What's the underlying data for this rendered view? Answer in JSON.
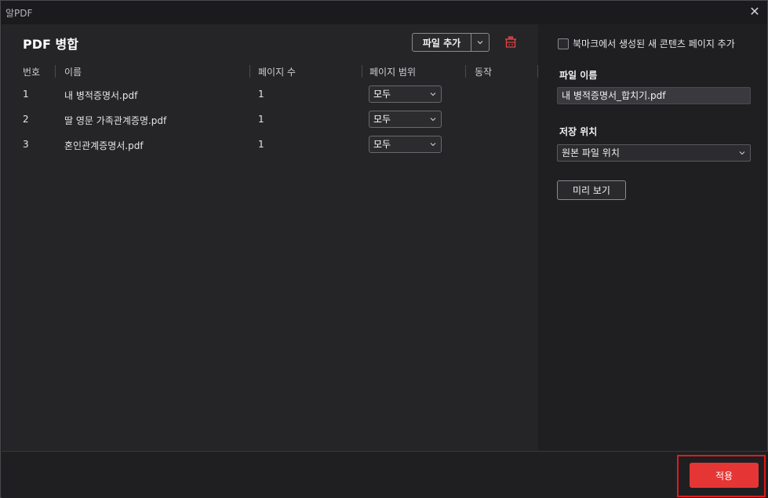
{
  "window": {
    "app_title": "알PDF"
  },
  "merge": {
    "title": "PDF 병합",
    "add_file_label": "파일 추가",
    "columns": {
      "number": "번호",
      "name": "이름",
      "pages": "페이지 수",
      "range": "페이지 범위",
      "action": "동작"
    },
    "files": [
      {
        "number": "1",
        "name": "내 병적증명서.pdf",
        "pages": "1",
        "range": "모두"
      },
      {
        "number": "2",
        "name": "딸 영문 가족관계증명.pdf",
        "pages": "1",
        "range": "모두"
      },
      {
        "number": "3",
        "name": "혼인관계증명서.pdf",
        "pages": "1",
        "range": "모두"
      }
    ]
  },
  "options": {
    "bookmark_label": "북마크에서 생성된 새 콘텐츠 페이지 추가",
    "file_name_label": "파일 이름",
    "file_name_value": "내 병적증명서_합치기.pdf",
    "save_location_label": "저장 위치",
    "save_location_value": "원본 파일 위치",
    "preview_label": "미리 보기"
  },
  "footer": {
    "apply_label": "적용"
  },
  "colors": {
    "accent": "#e63535",
    "highlight": "#e01b1b",
    "trash": "#e04545"
  }
}
